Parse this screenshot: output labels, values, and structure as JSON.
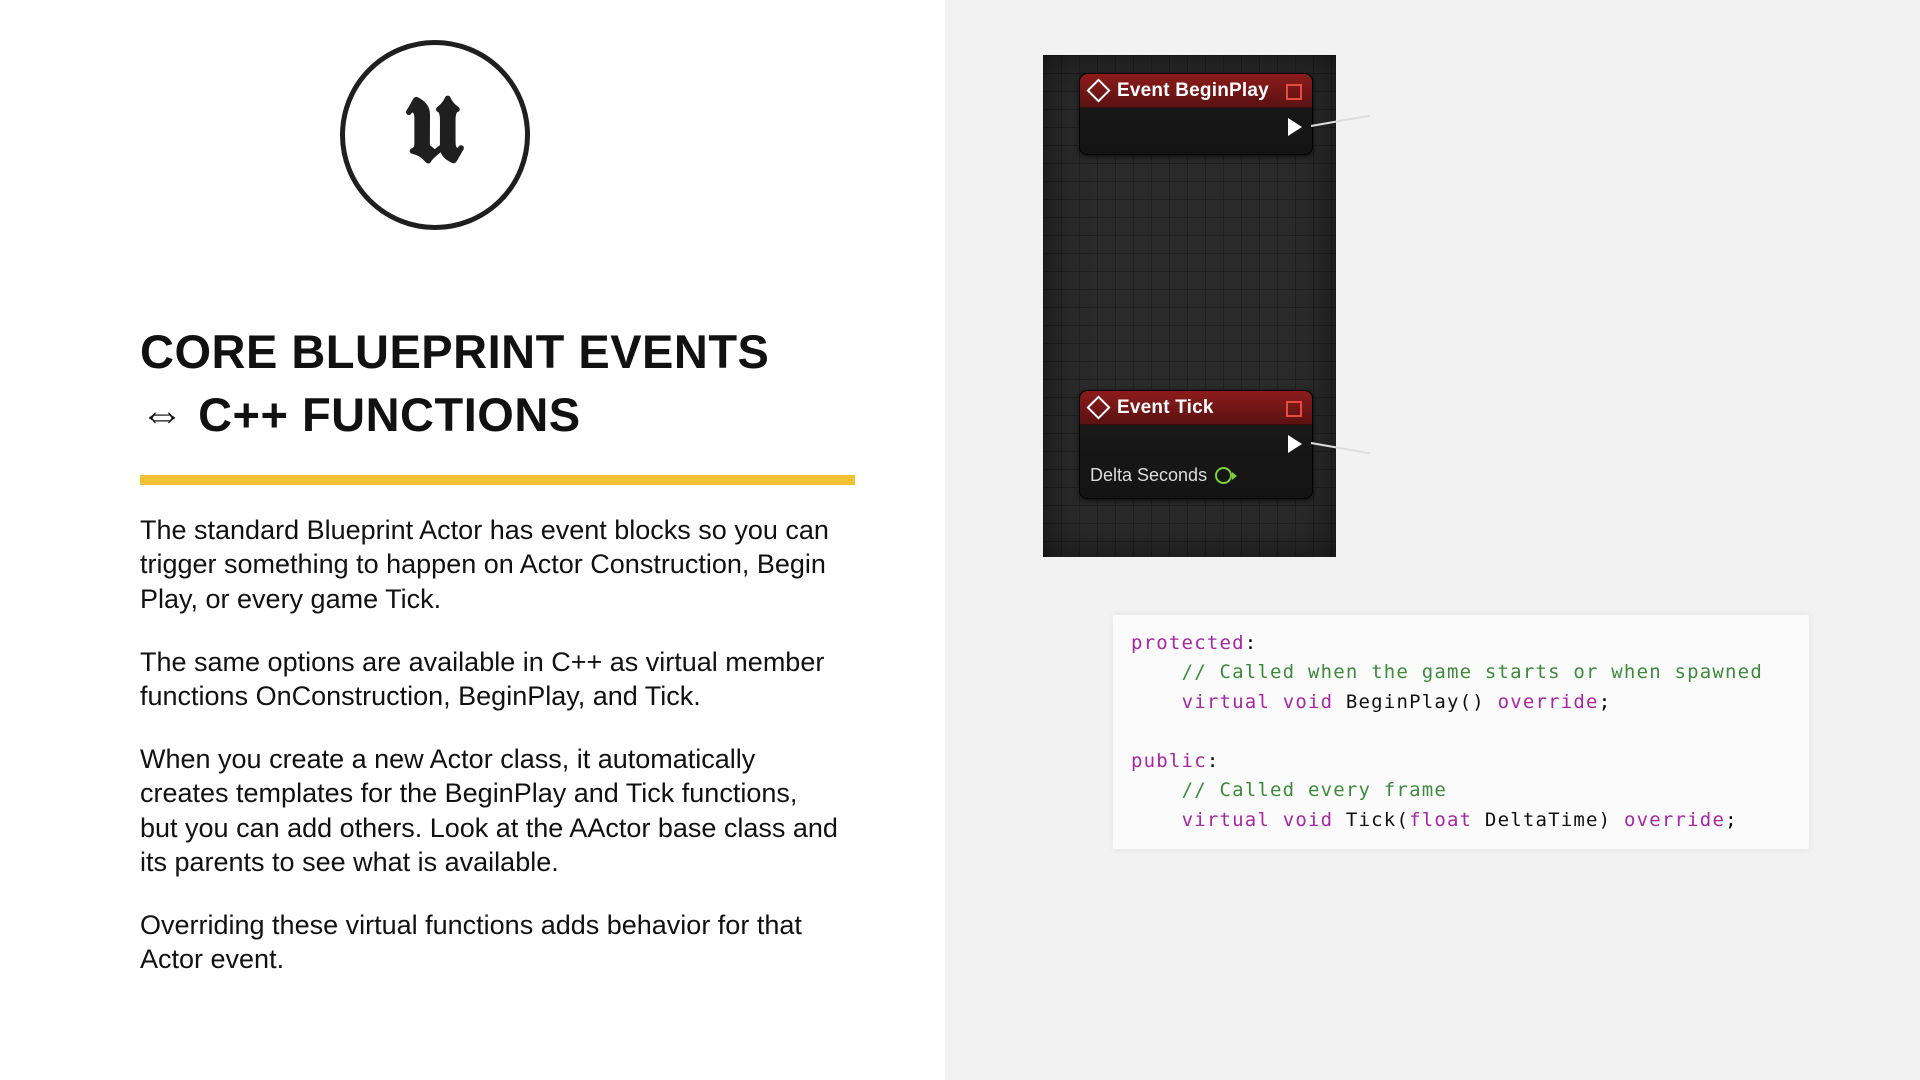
{
  "title_line1": "CORE BLUEPRINT EVENTS",
  "title_line2_arrow": "⇔",
  "title_line2_rest": "C++ FUNCTIONS",
  "paragraphs": [
    "The standard Blueprint Actor has event blocks so you can trigger something to happen on Actor Construction, Begin Play, or every game Tick.",
    "The same options are available in C++ as virtual member functions OnConstruction, BeginPlay, and Tick.",
    "When you create a new Actor class, it automatically creates templates for the BeginPlay and Tick functions, but you can add others. Look at the AActor base class and its parents to see what is available.",
    "Overriding these virtual functions adds behavior for that Actor event."
  ],
  "logo_letter": "u",
  "bp": {
    "begin_title": "Event BeginPlay",
    "tick_title": "Event Tick",
    "delta_label": "Delta Seconds"
  },
  "code": {
    "l1_kw": "protected",
    "l1_colon": ":",
    "l2_cmt": "// Called when the game starts or when spawned",
    "l3_virtual": "virtual",
    "l3_void": "void",
    "l3_fn": "BeginPlay()",
    "l3_override": "override",
    "l5_kw": "public",
    "l5_colon": ":",
    "l6_cmt": "// Called every frame",
    "l7_virtual": "virtual",
    "l7_void": "void",
    "l7_fn": "Tick(",
    "l7_float": "float",
    "l7_arg": " DeltaTime)",
    "l7_override": "override"
  }
}
